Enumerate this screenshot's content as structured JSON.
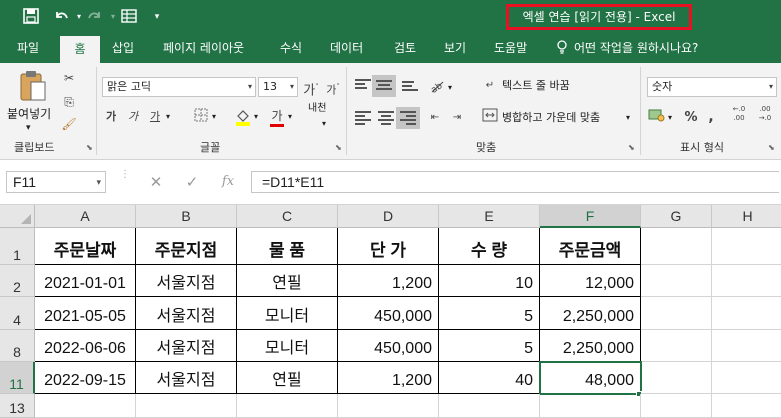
{
  "window": {
    "title": "엑셀 연습  [읽기 전용]  -  Excel",
    "accent_color": "#217346",
    "highlight_color": "#e81123"
  },
  "quick_access": {
    "icons": [
      "save-icon",
      "undo-icon",
      "redo-icon",
      "form-icon",
      "customize-icon"
    ]
  },
  "ribbon_tabs": {
    "items": [
      {
        "label": "파일"
      },
      {
        "label": "홈",
        "active": true
      },
      {
        "label": "삽입"
      },
      {
        "label": "페이지 레이아웃"
      },
      {
        "label": "수식"
      },
      {
        "label": "데이터"
      },
      {
        "label": "검토"
      },
      {
        "label": "보기"
      },
      {
        "label": "도움말"
      }
    ],
    "tell_me": "어떤 작업을 원하시나요?"
  },
  "ribbon": {
    "clipboard": {
      "paste_label": "붙여넣기",
      "group_label": "클립보드"
    },
    "font": {
      "font_name": "맑은 고딕",
      "font_size": "13",
      "group_label": "글꼴",
      "phonetic_label": "내천"
    },
    "alignment": {
      "wrap_text": "텍스트 줄 바꿈",
      "merge_center": "병합하고 가운데 맞춤",
      "group_label": "맞춤"
    },
    "number": {
      "format": "숫자",
      "group_label": "표시 형식"
    }
  },
  "formula_bar": {
    "name_box": "F11",
    "formula": "=D11*E11",
    "fx_label": "fx"
  },
  "grid": {
    "columns": [
      "A",
      "B",
      "C",
      "D",
      "E",
      "F",
      "G",
      "H"
    ],
    "selected_column": "F",
    "rows": [
      "1",
      "2",
      "4",
      "8",
      "11",
      "13"
    ],
    "selected_row": "11",
    "active_cell": "F11",
    "table": {
      "headers": [
        "주문날짜",
        "주문지점",
        "물 품",
        "단 가",
        "수 량",
        "주문금액"
      ],
      "data": [
        [
          "2021-01-01",
          "서울지점",
          "연필",
          "1,200",
          "10",
          "12,000"
        ],
        [
          "2021-05-05",
          "서울지점",
          "모니터",
          "450,000",
          "5",
          "2,250,000"
        ],
        [
          "2022-06-06",
          "서울지점",
          "모니터",
          "450,000",
          "5",
          "2,250,000"
        ],
        [
          "2022-09-15",
          "서울지점",
          "연필",
          "1,200",
          "40",
          "48,000"
        ]
      ]
    }
  }
}
